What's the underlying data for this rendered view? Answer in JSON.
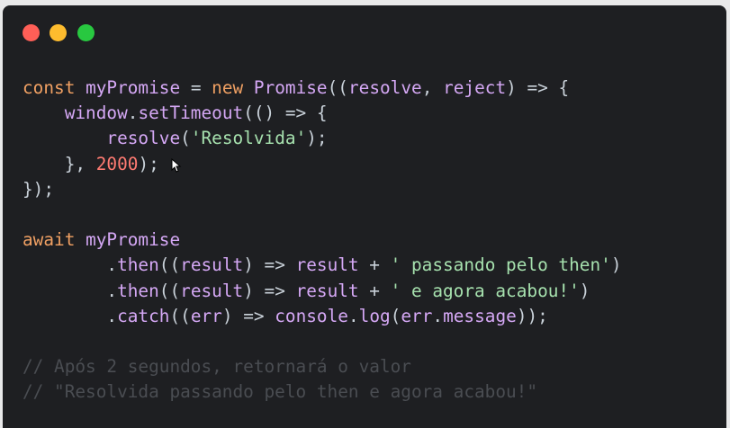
{
  "window": {
    "buttons": [
      {
        "name": "close",
        "color": "#ff5f57"
      },
      {
        "name": "minimize",
        "color": "#febc2e"
      },
      {
        "name": "maximize",
        "color": "#28c840"
      }
    ]
  },
  "colors": {
    "background": "#1e1f22",
    "keyword": "#f0a063",
    "identifier": "#d5a8f5",
    "default": "#c9d1d9",
    "string": "#a6e1ae",
    "number": "#ff7b72",
    "comment": "#4a4d52"
  },
  "code": {
    "lines": [
      [
        {
          "t": "const",
          "c": "keyword"
        },
        {
          "t": " ",
          "c": "default"
        },
        {
          "t": "myPromise",
          "c": "identifier"
        },
        {
          "t": " = ",
          "c": "default"
        },
        {
          "t": "new",
          "c": "keyword"
        },
        {
          "t": " ",
          "c": "default"
        },
        {
          "t": "Promise",
          "c": "identifier"
        },
        {
          "t": "((",
          "c": "default"
        },
        {
          "t": "resolve",
          "c": "identifier"
        },
        {
          "t": ", ",
          "c": "default"
        },
        {
          "t": "reject",
          "c": "identifier"
        },
        {
          "t": ") => {",
          "c": "default"
        }
      ],
      [
        {
          "t": "    ",
          "c": "default"
        },
        {
          "t": "window",
          "c": "identifier"
        },
        {
          "t": ".",
          "c": "default"
        },
        {
          "t": "setTimeout",
          "c": "identifier"
        },
        {
          "t": "(() => {",
          "c": "default"
        }
      ],
      [
        {
          "t": "        ",
          "c": "default"
        },
        {
          "t": "resolve",
          "c": "identifier"
        },
        {
          "t": "(",
          "c": "default"
        },
        {
          "t": "'Resolvida'",
          "c": "string"
        },
        {
          "t": ");",
          "c": "default"
        }
      ],
      [
        {
          "t": "    }, ",
          "c": "default"
        },
        {
          "t": "2000",
          "c": "number"
        },
        {
          "t": ");",
          "c": "default"
        }
      ],
      [
        {
          "t": "});",
          "c": "default"
        }
      ],
      [],
      [
        {
          "t": "await",
          "c": "keyword"
        },
        {
          "t": " ",
          "c": "default"
        },
        {
          "t": "myPromise",
          "c": "identifier"
        }
      ],
      [
        {
          "t": "        .",
          "c": "default"
        },
        {
          "t": "then",
          "c": "identifier"
        },
        {
          "t": "((",
          "c": "default"
        },
        {
          "t": "result",
          "c": "identifier"
        },
        {
          "t": ") => ",
          "c": "default"
        },
        {
          "t": "result",
          "c": "identifier"
        },
        {
          "t": " + ",
          "c": "default"
        },
        {
          "t": "' passando pelo then'",
          "c": "string"
        },
        {
          "t": ")",
          "c": "default"
        }
      ],
      [
        {
          "t": "        .",
          "c": "default"
        },
        {
          "t": "then",
          "c": "identifier"
        },
        {
          "t": "((",
          "c": "default"
        },
        {
          "t": "result",
          "c": "identifier"
        },
        {
          "t": ") => ",
          "c": "default"
        },
        {
          "t": "result",
          "c": "identifier"
        },
        {
          "t": " + ",
          "c": "default"
        },
        {
          "t": "' e agora acabou!'",
          "c": "string"
        },
        {
          "t": ")",
          "c": "default"
        }
      ],
      [
        {
          "t": "        .",
          "c": "default"
        },
        {
          "t": "catch",
          "c": "identifier"
        },
        {
          "t": "((",
          "c": "default"
        },
        {
          "t": "err",
          "c": "identifier"
        },
        {
          "t": ") => ",
          "c": "default"
        },
        {
          "t": "console",
          "c": "identifier"
        },
        {
          "t": ".",
          "c": "default"
        },
        {
          "t": "log",
          "c": "identifier"
        },
        {
          "t": "(",
          "c": "default"
        },
        {
          "t": "err",
          "c": "identifier"
        },
        {
          "t": ".",
          "c": "default"
        },
        {
          "t": "message",
          "c": "identifier"
        },
        {
          "t": "));",
          "c": "default"
        }
      ],
      [],
      [
        {
          "t": "// Após 2 segundos, retornará o valor",
          "c": "comment"
        }
      ],
      [
        {
          "t": "// \"Resolvida passando pelo then e agora acabou!\"",
          "c": "comment"
        }
      ]
    ]
  }
}
